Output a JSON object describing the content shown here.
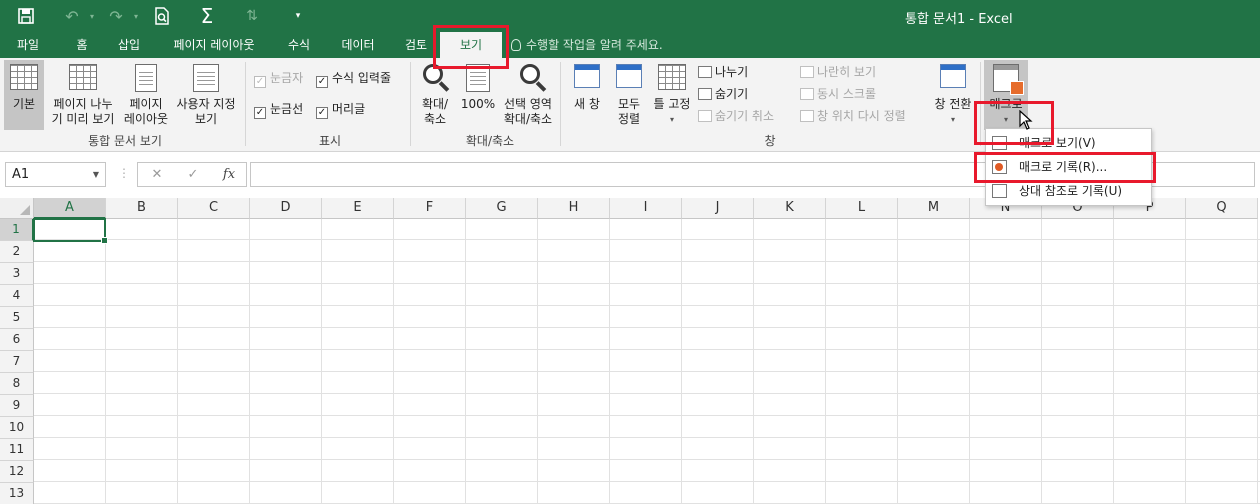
{
  "window": {
    "title": "통합 문서1 - Excel"
  },
  "qat": {
    "save_icon": "save-icon",
    "undo_icon": "undo-icon",
    "redo_icon": "redo-icon",
    "preview_icon": "print-preview-icon",
    "sum_icon": "autosum-icon",
    "sort_icon": "sort-icon",
    "customize_icon": "customize-qat-icon"
  },
  "tabs": [
    {
      "label": "파일"
    },
    {
      "label": "홈"
    },
    {
      "label": "삽입"
    },
    {
      "label": "페이지 레이아웃"
    },
    {
      "label": "수식"
    },
    {
      "label": "데이터"
    },
    {
      "label": "검토"
    },
    {
      "label": "보기"
    }
  ],
  "active_tab": "보기",
  "tell_me": "수행할 작업을 알려 주세요.",
  "ribbon": {
    "workbook_views": {
      "label": "통합 문서 보기",
      "normal": "기본",
      "page_break_1": "페이지 나누",
      "page_break_2": "기 미리 보기",
      "page_layout_1": "페이지",
      "page_layout_2": "레이아웃",
      "custom_1": "사용자 지정",
      "custom_2": "보기"
    },
    "show": {
      "label": "표시",
      "ruler": "눈금자",
      "formula_bar": "수식 입력줄",
      "gridlines": "눈금선",
      "headings": "머리글"
    },
    "zoom": {
      "label": "확대/축소",
      "zoom_1": "확대/",
      "zoom_2": "축소",
      "hundred": "100%",
      "selection_1": "선택 영역",
      "selection_2": "확대/축소"
    },
    "window": {
      "label": "창",
      "new_window": "새 창",
      "arrange_1": "모두",
      "arrange_2": "정렬",
      "freeze": "틀 고정",
      "split": "나누기",
      "hide": "숨기기",
      "unhide": "숨기기 취소",
      "side_by_side": "나란히 보기",
      "sync_scroll": "동시 스크롤",
      "reset_pos": "창 위치 다시 정렬",
      "switch": "창 전환"
    },
    "macros": {
      "label": "매크로"
    }
  },
  "macro_menu": [
    {
      "label": "매크로 보기(V)"
    },
    {
      "label": "매크로 기록(R)..."
    },
    {
      "label": "상대 참조로 기록(U)"
    }
  ],
  "formula_bar": {
    "name_box": "A1",
    "cancel": "✕",
    "enter": "✓",
    "fx": "fx",
    "value": ""
  },
  "columns": [
    "A",
    "B",
    "C",
    "D",
    "E",
    "F",
    "G",
    "H",
    "I",
    "J",
    "K",
    "L",
    "M",
    "N",
    "O",
    "P",
    "Q"
  ],
  "rows": [
    "1",
    "2",
    "3",
    "4",
    "5",
    "6",
    "7",
    "8",
    "9",
    "10",
    "11",
    "12",
    "13"
  ],
  "colors": {
    "excel_green": "#217346",
    "highlight_red": "#e8192c"
  }
}
